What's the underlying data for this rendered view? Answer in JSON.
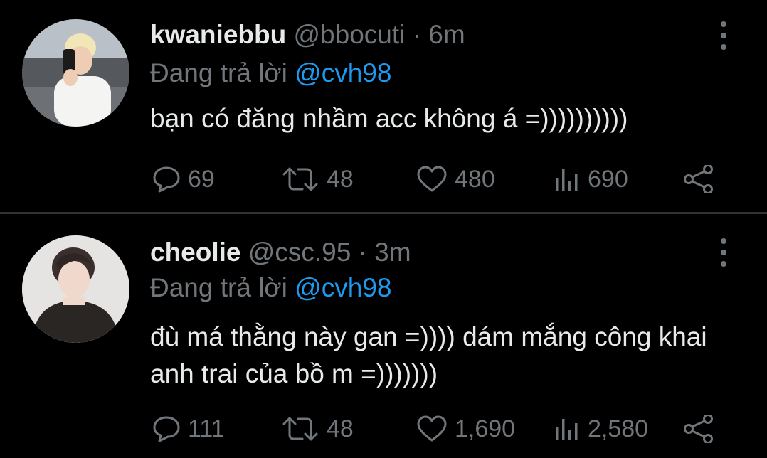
{
  "tweets": [
    {
      "display_name": "kwaniebbu",
      "handle": "@bbocuti",
      "separator": "·",
      "time": "6m",
      "reply_prefix": "Đang trả lời",
      "reply_to": "@cvh98",
      "text": "bạn có đăng nhầm acc không á =))))))))))",
      "stats": {
        "replies": "69",
        "retweets": "48",
        "likes": "480",
        "views": "690"
      }
    },
    {
      "display_name": "cheolie",
      "handle": "@csc.95",
      "separator": "·",
      "time": "3m",
      "reply_prefix": "Đang trả lời",
      "reply_to": "@cvh98",
      "text": "đù má thằng này gan =)))) dám mắng công khai anh trai của bồ m =)))))))",
      "stats": {
        "replies": "111",
        "retweets": "48",
        "likes": "1,690",
        "views": "2,580"
      }
    }
  ],
  "icons": {
    "reply": "speech-bubble-icon",
    "retweet": "retweet-arrows-icon",
    "like": "heart-icon",
    "views": "bar-chart-icon",
    "share": "share-icon",
    "more": "vertical-dots-icon"
  },
  "colors": {
    "background": "#000000",
    "primary_text": "#e7e9ea",
    "secondary_text": "#71767b",
    "mention": "#1d9bf0",
    "divider": "#2f3336"
  }
}
